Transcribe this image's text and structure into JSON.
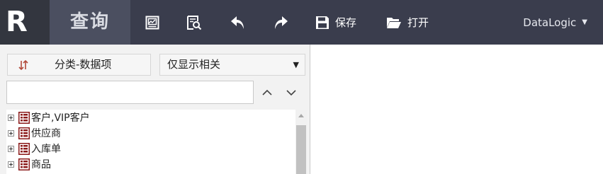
{
  "app": {
    "logo_letter": "R",
    "module_title": "查询"
  },
  "toolbar": {
    "chart_icon": "chart-icon",
    "preview_icon": "search-document-icon",
    "undo_icon": "undo-icon",
    "redo_icon": "redo-icon",
    "save_label": "保存",
    "open_label": "打开"
  },
  "user": {
    "name": "DataLogic",
    "caret": "▼"
  },
  "panel": {
    "sort_button_label": "分类-数据项",
    "filter_selected": "仅显示相关",
    "filter_arrow": "▼",
    "search_value": "",
    "search_placeholder": "",
    "tree_items": [
      {
        "label": "客户,VIP客户"
      },
      {
        "label": "供应商"
      },
      {
        "label": "入库单"
      },
      {
        "label": "商品"
      }
    ]
  },
  "colors": {
    "topbar": "#3a3d4d",
    "logo_bg": "#33363f",
    "module_bg": "#4b4f60",
    "table_icon": "#8b1a1a"
  }
}
